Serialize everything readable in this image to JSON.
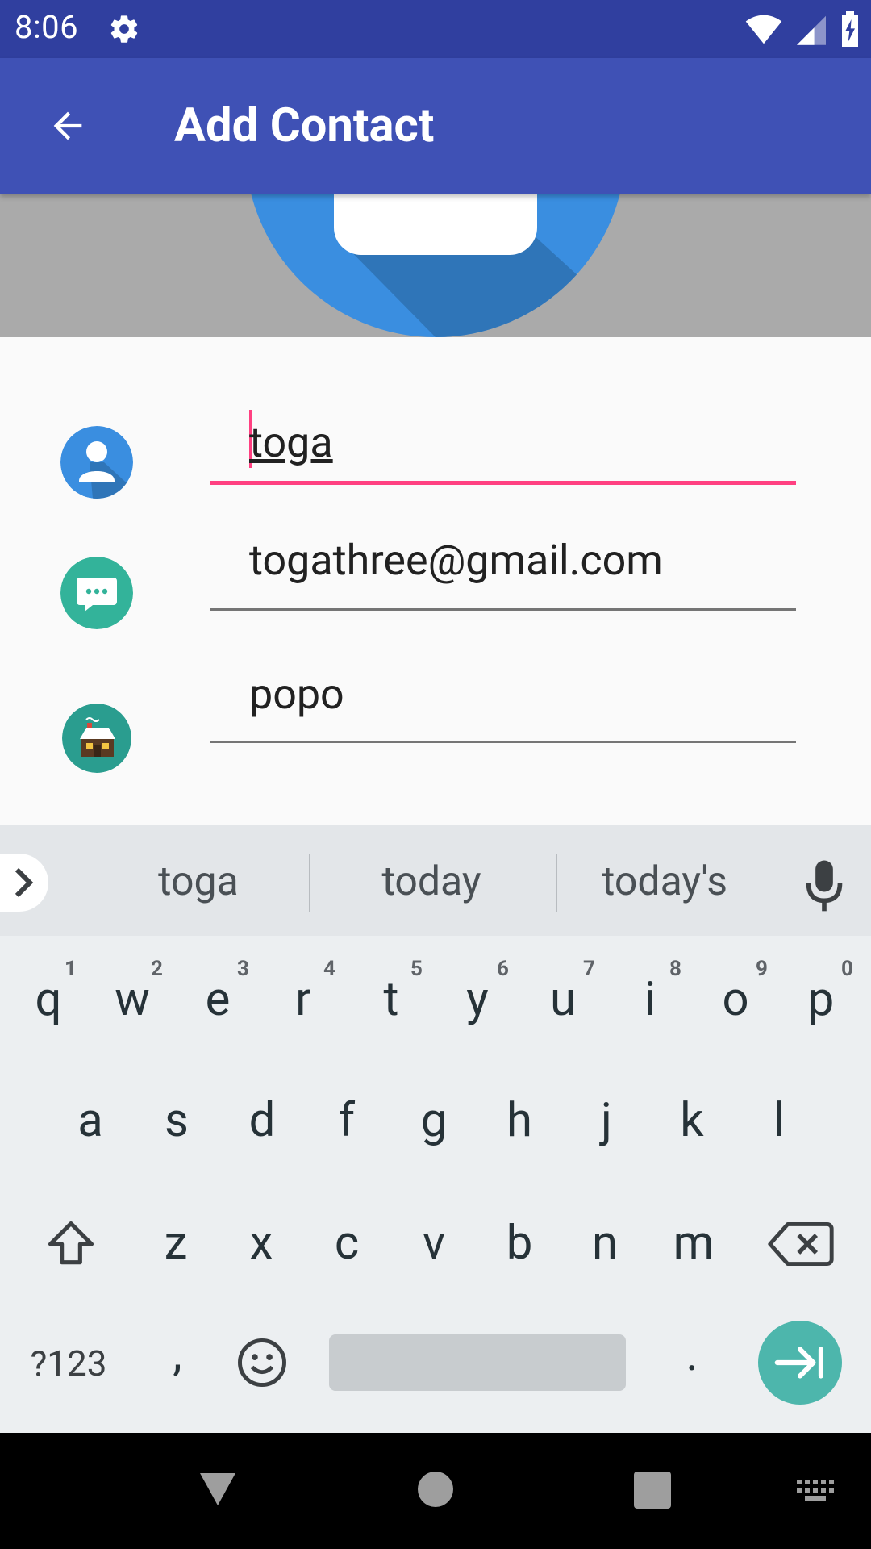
{
  "status_bar": {
    "time": "8:06",
    "icons": [
      "gear-icon",
      "wifi-icon",
      "signal-icon",
      "battery-charging-icon"
    ],
    "color": "#303F9F"
  },
  "app_bar": {
    "title": "Add Contact",
    "back_icon": "arrow-back-icon",
    "color": "#3F51B5"
  },
  "form": {
    "fields": [
      {
        "icon": "person-icon",
        "value": "toga",
        "focused": true
      },
      {
        "icon": "message-icon",
        "value": "togathree@gmail.com",
        "focused": false
      },
      {
        "icon": "house-icon",
        "value": "popo",
        "focused": false
      }
    ],
    "accent_color": "#FF4081"
  },
  "keyboard": {
    "suggestions": [
      "toga",
      "today",
      "today's"
    ],
    "row1": [
      "q",
      "w",
      "e",
      "r",
      "t",
      "y",
      "u",
      "i",
      "o",
      "p"
    ],
    "row1_hints": [
      "1",
      "2",
      "3",
      "4",
      "5",
      "6",
      "7",
      "8",
      "9",
      "0"
    ],
    "row2": [
      "a",
      "s",
      "d",
      "f",
      "g",
      "h",
      "j",
      "k",
      "l"
    ],
    "row3": [
      "z",
      "x",
      "c",
      "v",
      "b",
      "n",
      "m"
    ],
    "symbols_label": "?123",
    "comma": ",",
    "period": ".",
    "enter_color": "#4DB6AC"
  },
  "nav_bar": {
    "icons": [
      "back-triangle-icon",
      "home-circle-icon",
      "recents-square-icon",
      "keyboard-switch-icon"
    ]
  }
}
